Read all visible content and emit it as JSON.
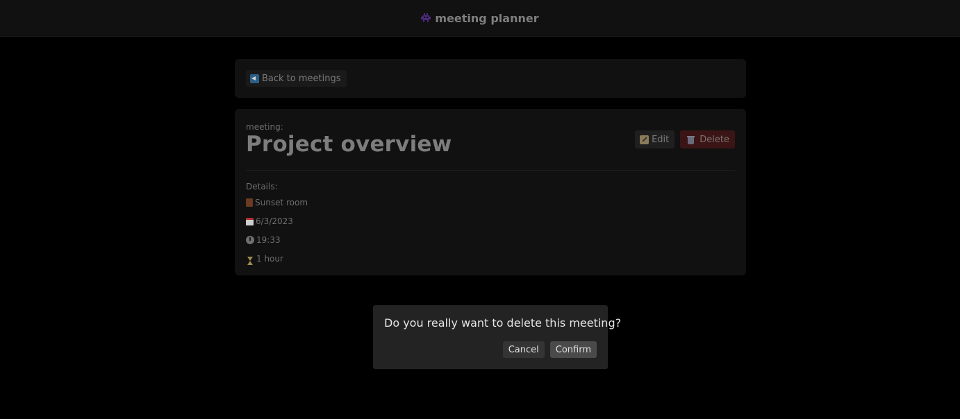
{
  "header": {
    "brand_name": "meeting planner",
    "brand_icon": "alien-monster-icon"
  },
  "nav": {
    "back_label": "Back to meetings",
    "back_icon": "back-arrow-icon"
  },
  "meeting": {
    "label": "meeting:",
    "title": "Project overview",
    "edit_label": "Edit",
    "delete_label": "Delete",
    "details_label": "Details:",
    "room": "Sunset room",
    "date": "6/3/2023",
    "time": "19:33",
    "duration": "1 hour"
  },
  "dialog": {
    "message": "Do you really want to delete this meeting?",
    "cancel_label": "Cancel",
    "confirm_label": "Confirm"
  },
  "colors": {
    "background": "#000000",
    "card": "#111111",
    "danger": "#3b1516",
    "dialog": "#232323",
    "brand_icon": "#4b2a75"
  }
}
